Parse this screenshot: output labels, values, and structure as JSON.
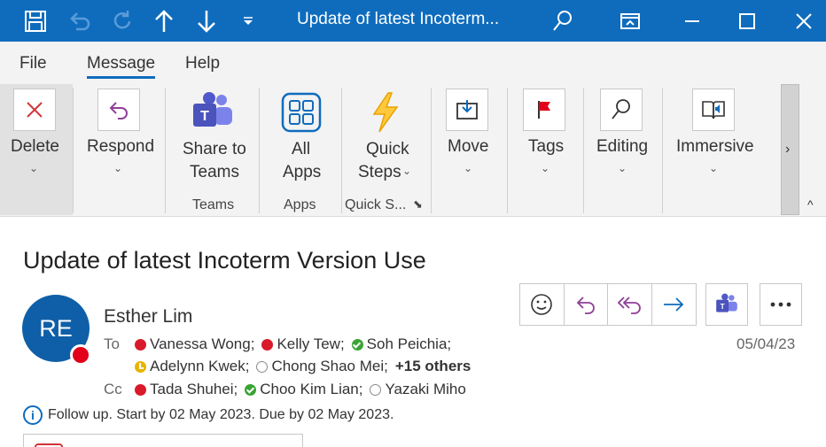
{
  "titlebar": {
    "title": "Update of  latest Incoterm...",
    "icons": [
      "save-icon",
      "undo-icon",
      "redo-icon",
      "up-arrow-icon",
      "down-arrow-icon",
      "customize-toolbar-icon",
      "search-icon",
      "ribbon-display-icon",
      "minimize-icon",
      "maximize-icon",
      "close-icon"
    ]
  },
  "tabs": [
    {
      "label": "File"
    },
    {
      "label": "Message"
    },
    {
      "label": "Help"
    }
  ],
  "ribbon": {
    "delete": {
      "label": "Delete"
    },
    "respond": {
      "label": "Respond"
    },
    "share": {
      "line1": "Share to",
      "line2": "Teams",
      "group": "Teams"
    },
    "apps": {
      "line1": "All",
      "line2": "Apps",
      "group": "Apps"
    },
    "quicksteps": {
      "line1": "Quick",
      "line2": "Steps",
      "group": "Quick S..."
    },
    "move": {
      "label": "Move"
    },
    "tags": {
      "label": "Tags"
    },
    "editing": {
      "label": "Editing"
    },
    "immersive": {
      "label": "Immersive"
    },
    "more": "›",
    "collapse": "^"
  },
  "message": {
    "subject": "Update of  latest Incoterm Version Use",
    "avatar_initials": "RE",
    "sender": "Esther Lim",
    "to_label": "To",
    "cc_label": "Cc",
    "to_line1": [
      {
        "name": "Vanessa Wong;",
        "status": "red"
      },
      {
        "name": "Kelly Tew;",
        "status": "red"
      },
      {
        "name": "Soh Peichia;",
        "status": "green"
      }
    ],
    "to_line2": [
      {
        "name": "Adelynn Kwek;",
        "status": "yellow"
      },
      {
        "name": "Chong Shao Mei;",
        "status": "empty"
      }
    ],
    "others": "+15 others",
    "cc_line": [
      {
        "name": "Tada Shuhei;",
        "status": "red"
      },
      {
        "name": "Choo Kim Lian;",
        "status": "green"
      },
      {
        "name": "Yazaki Miho",
        "status": "empty"
      }
    ],
    "date": "05/04/23",
    "followup": "Follow up.  Start by 02 May 2023.  Due by 02 May 2023.",
    "info_symbol": "i"
  },
  "colors": {
    "accent": "#0f6cbd",
    "busy": "#d91a2a",
    "available": "#3aa335",
    "away": "#e8b400",
    "reply": "#8f3f97"
  }
}
